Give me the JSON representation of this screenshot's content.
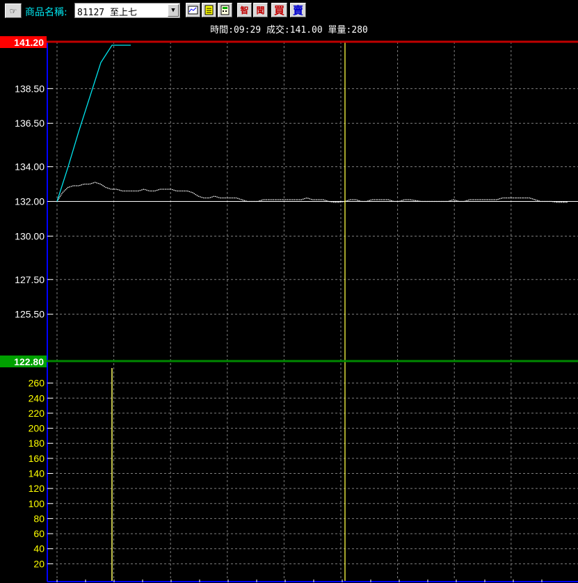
{
  "toolbar": {
    "product_label": "商品名稱:",
    "product_value": "81127 至上七",
    "buttons": [
      {
        "icon": "chart-icon",
        "label": ""
      },
      {
        "icon": "document-icon",
        "label": ""
      },
      {
        "icon": "calculator-icon",
        "label": ""
      },
      {
        "icon": "zhi-icon",
        "label": "智",
        "color": "#cc0000"
      },
      {
        "icon": "wen-icon",
        "label": "聞",
        "color": "#cc0000"
      },
      {
        "icon": "buy-icon",
        "label": "買",
        "color": "#cc0000"
      },
      {
        "icon": "sell-icon",
        "label": "賣",
        "color": "#0000cc"
      }
    ]
  },
  "status": "時間:09:29 成交:141.00 單量:280",
  "colors": {
    "upper_limit": "#c00000",
    "lower_limit": "#008800",
    "axis": "#0000ff",
    "price_line": "#ffffff",
    "avg_line": "#00e5ee",
    "cursor": "#ffff44",
    "volume_labels": "#ffff00"
  },
  "chart_data": [
    {
      "type": "line",
      "title": "",
      "upper_limit": "141.20",
      "lower_limit": "122.80",
      "y_ticks": [
        "138.50",
        "136.50",
        "134.00",
        "132.00",
        "130.00",
        "127.50",
        "125.50"
      ],
      "ylim": [
        122.8,
        141.2
      ],
      "reference_price": 132.0,
      "series": [
        {
          "values": [
            132.0,
            132.5,
            132.8,
            132.9,
            132.9,
            133.0,
            133.0,
            133.1,
            133.0,
            132.8,
            132.7,
            132.7,
            132.6,
            132.6,
            132.6,
            132.6,
            132.7,
            132.6,
            132.6,
            132.7,
            132.7,
            132.7,
            132.6,
            132.6,
            132.6,
            132.5,
            132.3,
            132.2,
            132.2,
            132.3,
            132.2,
            132.2,
            132.2,
            132.2,
            132.1,
            132.0,
            132.0,
            132.0,
            132.1,
            132.1,
            132.1,
            132.1,
            132.1,
            132.1,
            132.1,
            132.1,
            132.2,
            132.1,
            132.1,
            132.1,
            132.0,
            131.95,
            131.95,
            132.0,
            132.1,
            132.1,
            132.0,
            132.0,
            132.1,
            132.1,
            132.1,
            132.1,
            132.0,
            132.0,
            132.1,
            132.1,
            132.05,
            132.0,
            132.0,
            132.0,
            132.0,
            132.0,
            132.0,
            132.1,
            132.0,
            132.0,
            132.1,
            132.1,
            132.1,
            132.1,
            132.1,
            132.1,
            132.2,
            132.2,
            132.2,
            132.2,
            132.2,
            132.2,
            132.1,
            132.0,
            132.0,
            132.0,
            131.95,
            131.95,
            131.95
          ]
        },
        {
          "values": [
            132.0,
            134.0,
            136.0,
            138.0,
            140.0,
            141.0,
            141.0,
            141.0
          ]
        }
      ],
      "grid": true
    },
    {
      "type": "bar",
      "y_ticks": [
        "260",
        "240",
        "220",
        "200",
        "180",
        "160",
        "140",
        "120",
        "100",
        "80",
        "60",
        "40",
        "20"
      ],
      "ylim": [
        0,
        280
      ],
      "values": [
        280
      ],
      "grid": true
    }
  ]
}
